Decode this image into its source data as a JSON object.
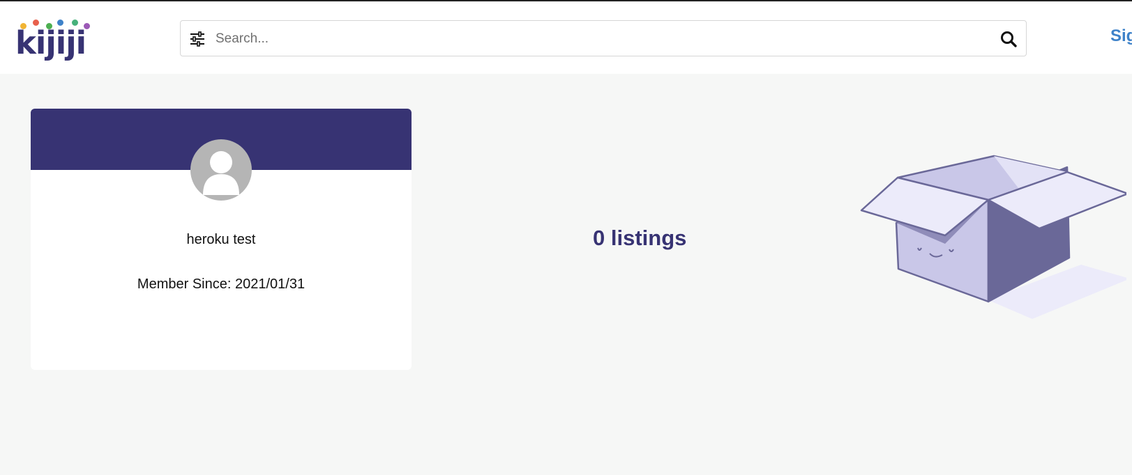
{
  "header": {
    "logo_text": "kijiji",
    "logo_dot_colors": [
      "#f1b434",
      "#e8604c",
      "#4caf50",
      "#3e82c9",
      "#46b17b",
      "#9b59b6"
    ],
    "search": {
      "placeholder": "Search...",
      "value": ""
    },
    "signin_label": "Sig"
  },
  "profile": {
    "name": "heroku test",
    "member_since": "Member Since: 2021/01/31",
    "banner_color": "#373373"
  },
  "listings": {
    "count_label": "0 listings"
  },
  "colors": {
    "brand": "#373373",
    "link": "#3e82c9",
    "page_bg": "#f6f7f6"
  }
}
